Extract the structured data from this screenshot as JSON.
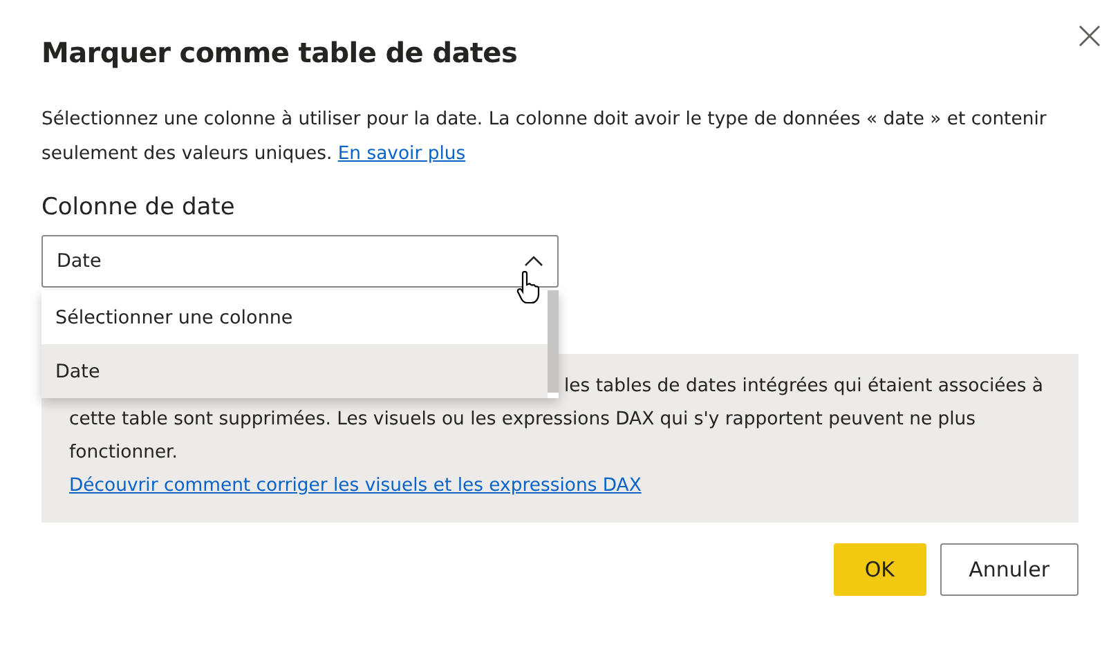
{
  "dialog": {
    "title": "Marquer comme table de dates",
    "description": "Sélectionnez une colonne à utiliser pour la date. La colonne doit avoir le type de données « date » et contenir seulement des valeurs uniques.",
    "learn_more_link": "En savoir plus"
  },
  "date_column": {
    "label": "Colonne de date",
    "value": "Date",
    "expanded": true,
    "options": [
      {
        "label": "Sélectionner une colonne",
        "selected": false
      },
      {
        "label": "Date",
        "selected": true
      }
    ]
  },
  "warning": {
    "lines": [
      "les tables de dates intégrées qui étaient associées à",
      "cette table sont supprimées. Les visuels ou les expressions DAX qui s'y rapportent peuvent ne plus fonctionner."
    ],
    "link": "Découvrir comment corriger les visuels et les expressions DAX"
  },
  "buttons": [
    {
      "label": "OK",
      "kind": "primary"
    },
    {
      "label": "Annuler",
      "kind": "secondary"
    }
  ]
}
